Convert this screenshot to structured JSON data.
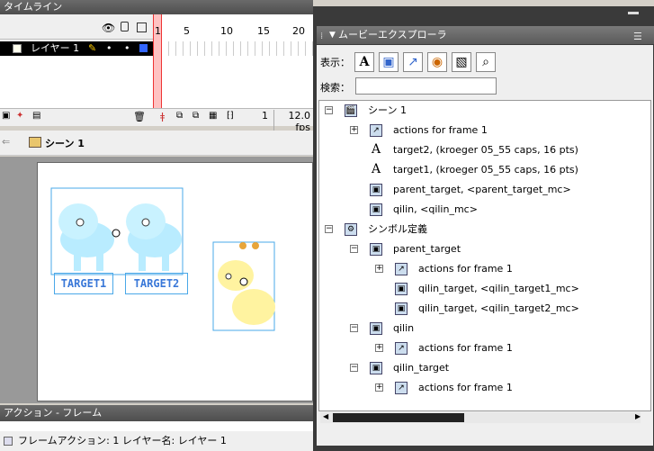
{
  "timeline": {
    "title": "タイムライン",
    "frame_numbers": [
      "1",
      "5",
      "10",
      "15",
      "20"
    ],
    "layer_name": "レイヤー 1",
    "current_frame": "1",
    "fps": "12.0 fps"
  },
  "stage": {
    "scene_label": "シーン 1",
    "target1_label": "TARGET1",
    "target2_label": "TARGET2"
  },
  "actions_panel": {
    "title": "アクション - フレーム",
    "status": "フレームアクション: 1 レイヤー名: レイヤー 1"
  },
  "explorer": {
    "title": "ムービーエクスプローラ",
    "show_label": "表示：",
    "search_label": "検索：",
    "search_value": "",
    "tree": [
      {
        "text": "シーン 1",
        "indent": 0,
        "icon": "scene-icon",
        "toggle": "−"
      },
      {
        "text": "actions for frame 1",
        "indent": 1,
        "icon": "action-icon",
        "toggle": "+"
      },
      {
        "text": "target2, (kroeger 05_55 caps, 16 pts)",
        "indent": 1,
        "icon": "text-icon",
        "toggle": ""
      },
      {
        "text": "target1, (kroeger 05_55 caps, 16 pts)",
        "indent": 1,
        "icon": "text-icon",
        "toggle": ""
      },
      {
        "text": "parent_target, <parent_target_mc>",
        "indent": 1,
        "icon": "movieclip-icon",
        "toggle": ""
      },
      {
        "text": "qilin, <qilin_mc>",
        "indent": 1,
        "icon": "movieclip-icon",
        "toggle": ""
      },
      {
        "text": "シンボル定義",
        "indent": 0,
        "icon": "symbol-icon",
        "toggle": "−"
      },
      {
        "text": "parent_target",
        "indent": 1,
        "icon": "movieclip-icon",
        "toggle": "−"
      },
      {
        "text": "actions for frame 1",
        "indent": 2,
        "icon": "action-icon",
        "toggle": "+"
      },
      {
        "text": "qilin_target, <qilin_target1_mc>",
        "indent": 2,
        "icon": "movieclip-icon",
        "toggle": ""
      },
      {
        "text": "qilin_target, <qilin_target2_mc>",
        "indent": 2,
        "icon": "movieclip-icon",
        "toggle": ""
      },
      {
        "text": "qilin",
        "indent": 1,
        "icon": "movieclip-icon",
        "toggle": "−"
      },
      {
        "text": "actions for frame 1",
        "indent": 2,
        "icon": "action-icon",
        "toggle": "+"
      },
      {
        "text": "qilin_target",
        "indent": 1,
        "icon": "movieclip-icon",
        "toggle": "−"
      },
      {
        "text": "actions for frame 1",
        "indent": 2,
        "icon": "action-icon",
        "toggle": "+"
      }
    ]
  }
}
